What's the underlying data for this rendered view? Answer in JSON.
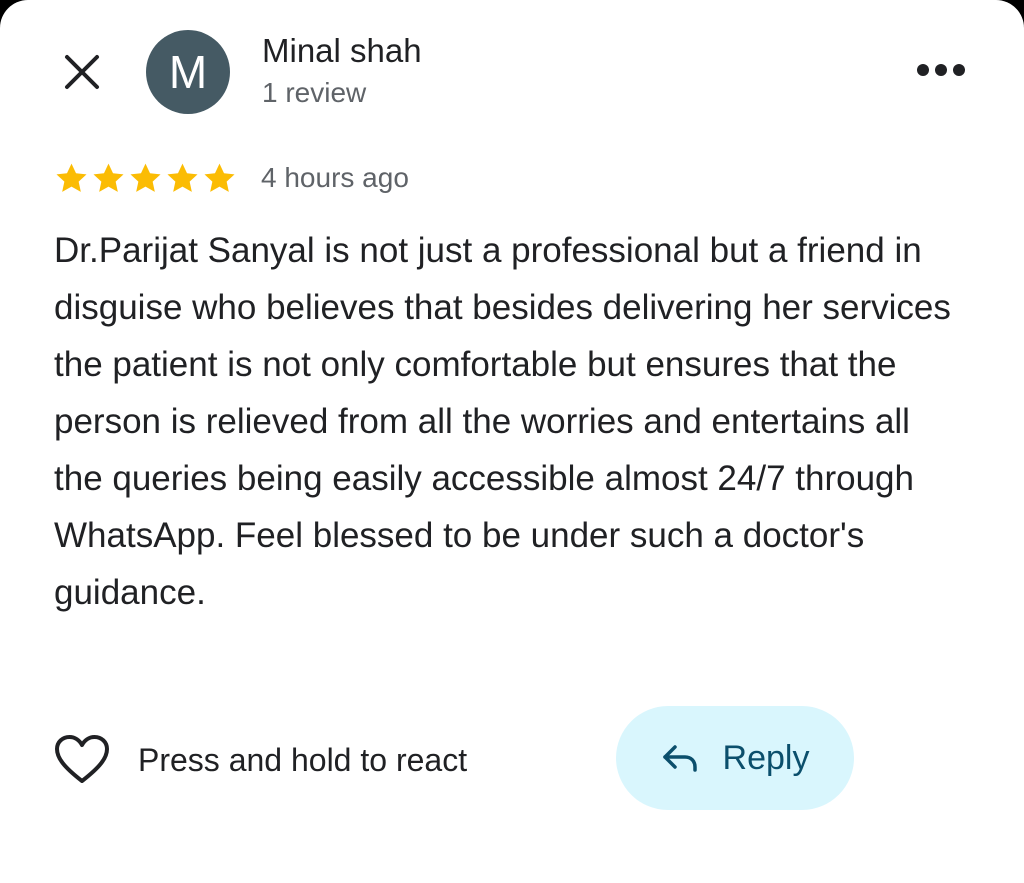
{
  "review": {
    "author": {
      "initial": "M",
      "name": "Minal shah",
      "review_count": "1 review",
      "avatar_color": "#455a64"
    },
    "rating": 5,
    "star_color": "#fbbc04",
    "time_ago": "4 hours ago",
    "text": "Dr.Parijat Sanyal is not just a professional but a friend in disguise who believes that besides delivering her services the patient is not only comfortable but ensures that the person is relieved from all the worries and entertains all the queries being easily accessible almost 24/7 through WhatsApp. Feel blessed to be under such a doctor's guidance."
  },
  "actions": {
    "react_label": "Press and hold to react",
    "reply_label": "Reply",
    "reply_bg_color": "#d9f6fd"
  },
  "icons": {
    "close": "close-icon",
    "more": "more-horizontal-icon",
    "heart": "heart-outline-icon",
    "reply": "reply-arrow-icon",
    "star": "star-filled-icon"
  }
}
